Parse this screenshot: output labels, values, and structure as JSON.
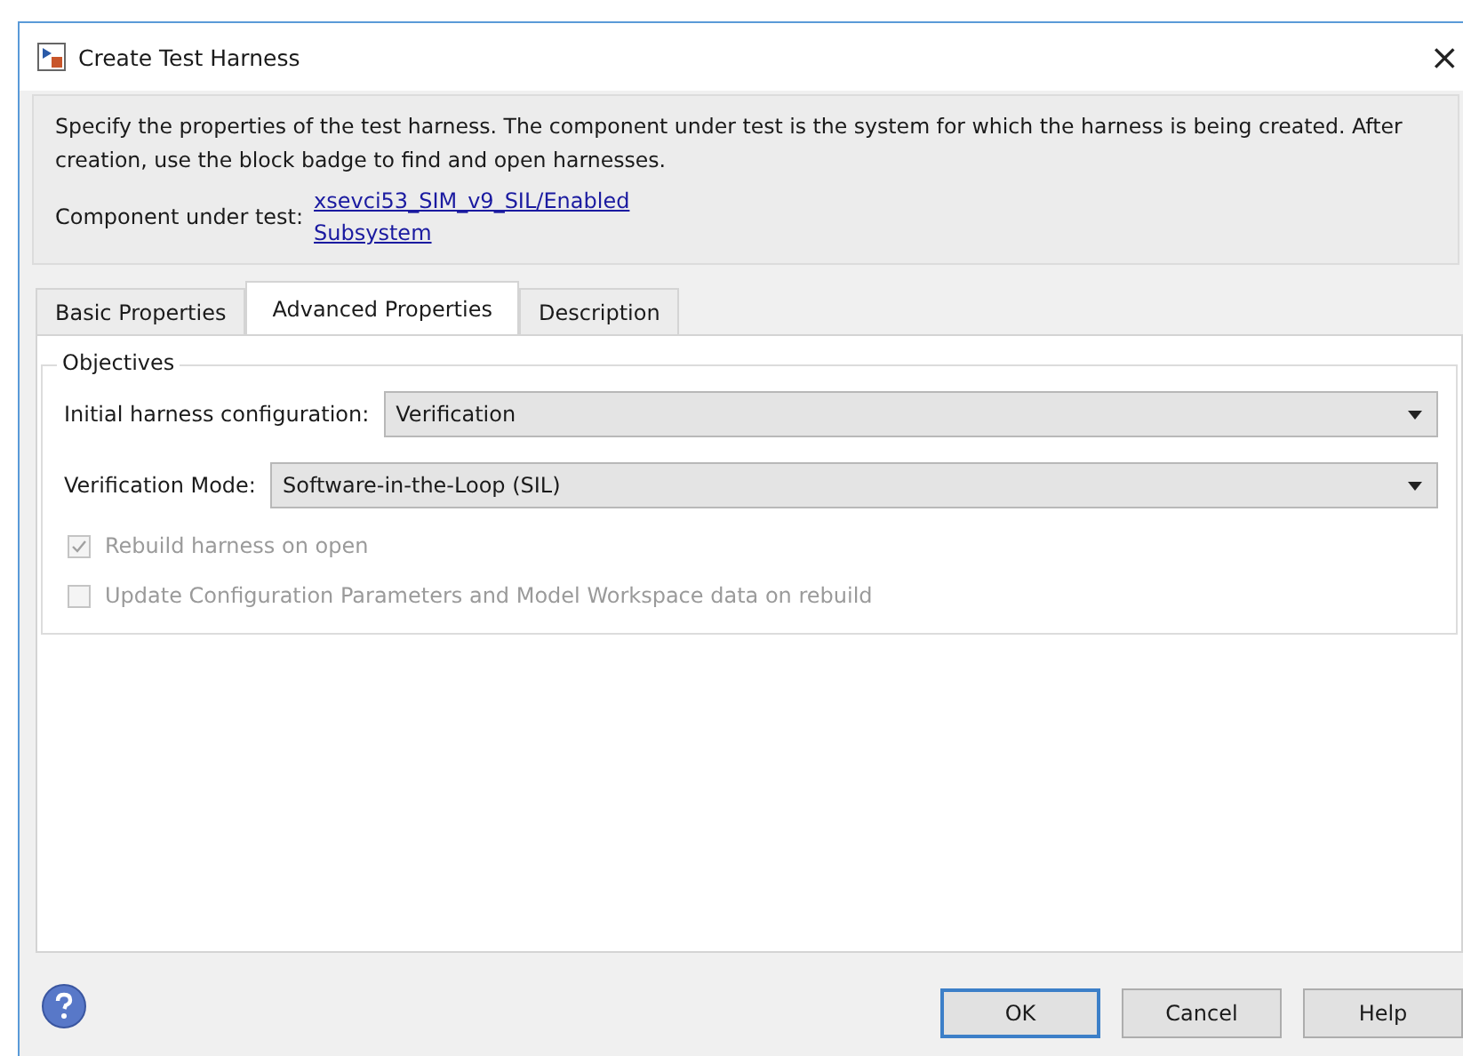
{
  "window": {
    "title": "Create Test Harness",
    "close": "×"
  },
  "description": {
    "text": "Specify the properties of the test harness. The component under test is the system for which the harness is being created. After creation, use the block badge to find and open harnesses.",
    "component_label": "Component under test:",
    "component_link": "xsevci53_SIM_v9_SIL/Enabled Subsystem"
  },
  "tabs": [
    {
      "label": "Basic Properties",
      "selected": false
    },
    {
      "label": "Advanced Properties",
      "selected": true
    },
    {
      "label": "Description",
      "selected": false
    }
  ],
  "group": {
    "title": "Objectives"
  },
  "dropdowns": [
    {
      "label": "Initial harness configuration:",
      "value": "Verification"
    },
    {
      "label": "Verification Mode:",
      "value": "Software-in-the-Loop (SIL)"
    }
  ],
  "checkboxes": [
    {
      "label": "Rebuild harness on open",
      "checked": true,
      "disabled": true
    },
    {
      "label": "Update Configuration Parameters and Model Workspace data on rebuild",
      "checked": false,
      "disabled": true
    }
  ],
  "buttons": [
    {
      "label": "OK",
      "default": true
    },
    {
      "label": "Cancel",
      "default": false
    },
    {
      "label": "Help",
      "default": false
    }
  ]
}
